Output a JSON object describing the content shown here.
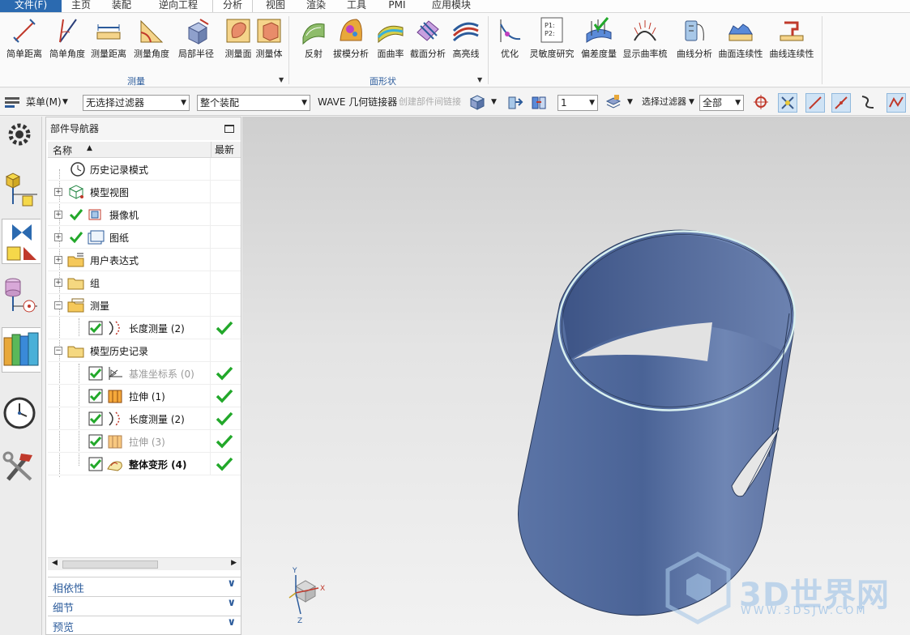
{
  "menu_tabs": [
    "文件(F)",
    "主页",
    "装配",
    "逆向工程",
    "分析",
    "视图",
    "渲染",
    "工具",
    "PMI",
    "应用模块"
  ],
  "ribbon": {
    "measure_buttons": [
      "简单距离",
      "简单角度",
      "测量距离",
      "测量角度",
      "局部半径",
      "测量面",
      "测量体"
    ],
    "measure_group": "测量",
    "shape_buttons": [
      "反射",
      "拔模分析",
      "面曲率",
      "截面分析",
      "高亮线"
    ],
    "shape_group": "面形状",
    "other_buttons": [
      "优化",
      "灵敏度研究",
      "偏差度量",
      "显示曲率梳",
      "曲线分析",
      "曲面连续性",
      "曲线连续性"
    ]
  },
  "toolbar": {
    "menu_label": "菜单(M)",
    "filter_combo": "无选择过滤器",
    "assembly_combo": "整个装配",
    "wave_label": "WAVE 几何链接器",
    "create_intermediate": "创建部件间链接",
    "layer_combo": "1",
    "select_filter_label": "选择过滤器",
    "scope_combo": "全部"
  },
  "navigator": {
    "title": "部件导航器",
    "col_name": "名称",
    "col_latest": "最新",
    "rows": [
      {
        "label": "历史记录模式"
      },
      {
        "label": "模型视图"
      },
      {
        "label": "摄像机"
      },
      {
        "label": "图纸"
      },
      {
        "label": "用户表达式"
      },
      {
        "label": "组"
      },
      {
        "label": "测量"
      },
      {
        "label": "长度测量 (2)"
      },
      {
        "label": "模型历史记录"
      },
      {
        "label": "基准坐标系 (0)"
      },
      {
        "label": "拉伸 (1)"
      },
      {
        "label": "长度测量 (2)"
      },
      {
        "label": "拉伸 (3)"
      },
      {
        "label": "整体变形 (4)"
      }
    ],
    "panels": [
      "相依性",
      "细节",
      "预览"
    ]
  },
  "triad": {
    "x": "X",
    "y": "Y",
    "z": "Z"
  },
  "watermark": {
    "text": "3D世界网",
    "url": "WWW.3DSJW.COM"
  },
  "colors": {
    "file_tab": "#2b6ab0",
    "model_surface": "#5b74a6",
    "check_green": "#22a82a",
    "accent_blue": "#2b5b9b"
  }
}
